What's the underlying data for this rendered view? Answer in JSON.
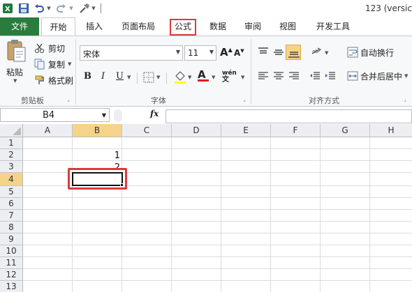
{
  "window": {
    "title": "123 (versic"
  },
  "quick_access": {
    "icons": [
      "excel-logo-icon",
      "save-icon",
      "undo-icon",
      "redo-icon",
      "customize-icon"
    ]
  },
  "tabs": [
    {
      "label": "文件",
      "active": false,
      "file": true
    },
    {
      "label": "开始",
      "active": true
    },
    {
      "label": "插入"
    },
    {
      "label": "页面布局"
    },
    {
      "label": "公式",
      "highlighted": true
    },
    {
      "label": "数据"
    },
    {
      "label": "审阅"
    },
    {
      "label": "视图"
    },
    {
      "label": "开发工具"
    }
  ],
  "ribbon": {
    "clipboard": {
      "paste": "粘贴",
      "cut": "剪切",
      "copy": "复制",
      "format_painter": "格式刷",
      "group": "剪贴板"
    },
    "font": {
      "name": "宋体",
      "size": "11",
      "group": "字体",
      "bold": "B",
      "italic": "I",
      "underline": "U",
      "grow": "A",
      "shrink": "A",
      "font_color": "A",
      "phonetic": "wén"
    },
    "alignment": {
      "wrap": "自动换行",
      "merge": "合并后居中",
      "group": "对齐方式"
    }
  },
  "formula_bar": {
    "name_box": "B4",
    "fx": "fx",
    "value": ""
  },
  "sheet": {
    "columns": [
      "A",
      "B",
      "C",
      "D",
      "E",
      "F",
      "G",
      "H"
    ],
    "rows": [
      "1",
      "2",
      "3",
      "4",
      "5",
      "6",
      "7",
      "8",
      "9",
      "10",
      "11",
      "12",
      "13"
    ],
    "selected_cell": "B4",
    "cells": {
      "B2": "1",
      "B3": "2"
    }
  },
  "colors": {
    "file_tab": "#2a7c3d",
    "highlight": "#e0383e",
    "selected_header": "#f6d38a"
  }
}
